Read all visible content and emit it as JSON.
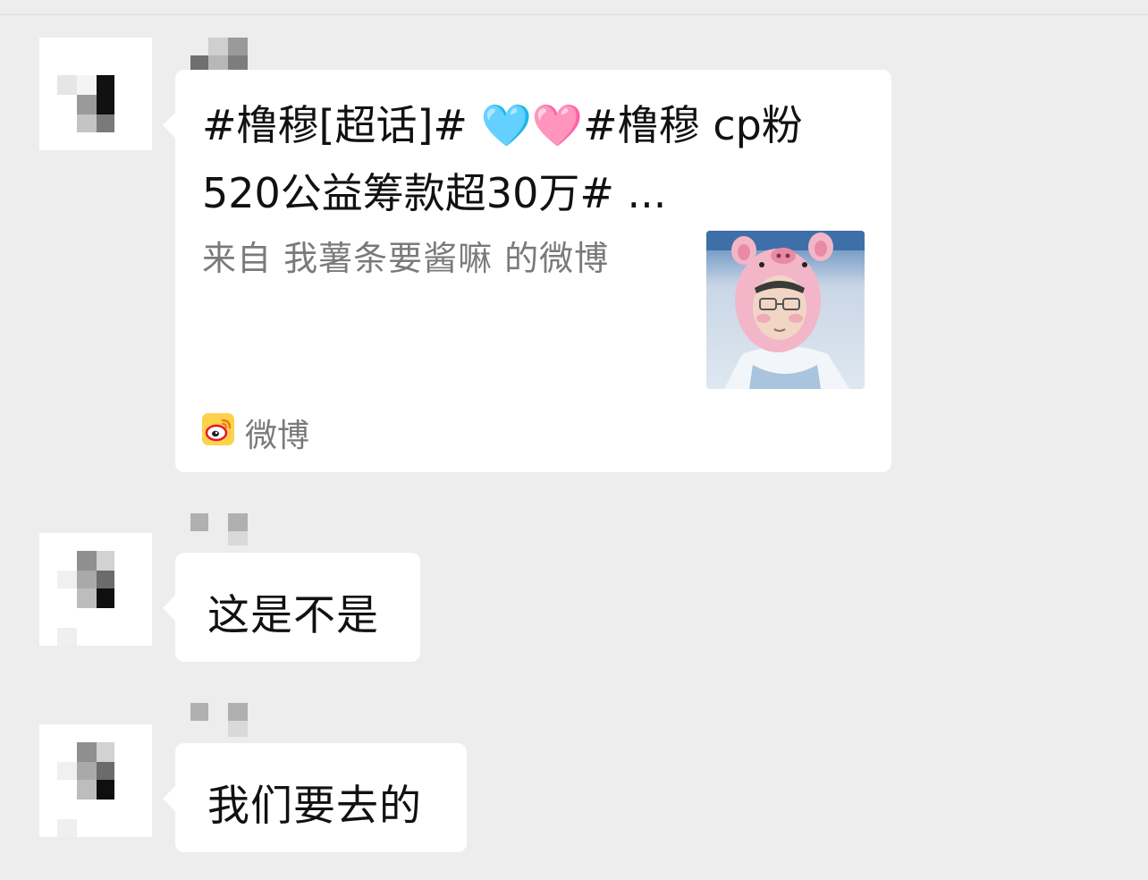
{
  "chat": {
    "messages": [
      {
        "type": "share_card",
        "card": {
          "title_line1": "#橹穆[超话]# 🩵🩷#橹穆 cp粉",
          "title_line2": "520公益筹款超30万# ...",
          "source": "来自 我薯条要酱嘛 的微博",
          "app_name": "微博",
          "app_icon": "weibo-icon",
          "thumbnail": "pig-hat-photo"
        }
      },
      {
        "type": "text",
        "text": "这是不是"
      },
      {
        "type": "text",
        "text": "我们要去的"
      }
    ]
  },
  "colors": {
    "background": "#ededed",
    "bubble": "#ffffff",
    "primary_text": "#111111",
    "secondary_text": "#7a7a7a",
    "weibo_brand": "#e6162d",
    "weibo_yellow": "#fdd24a"
  }
}
